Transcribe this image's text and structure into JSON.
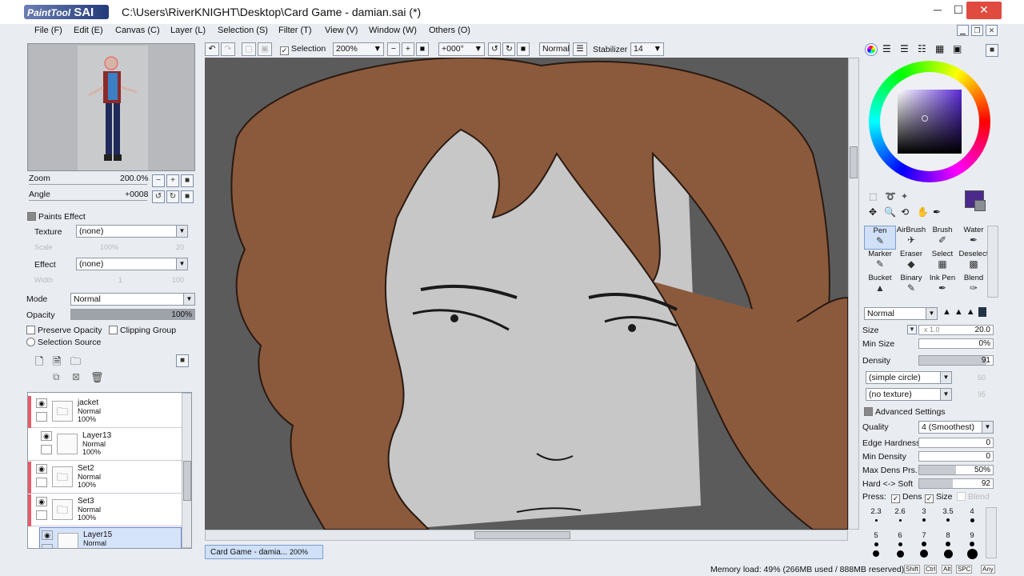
{
  "window": {
    "app_logo": "PaintTool",
    "app_logo_sai": "SAI",
    "title": "C:\\Users\\RiverKNIGHT\\Desktop\\Card Game - damian.sai (*)"
  },
  "menus": [
    "File (F)",
    "Edit (E)",
    "Canvas (C)",
    "Layer (L)",
    "Selection (S)",
    "Filter (T)",
    "View (V)",
    "Window (W)",
    "Others (O)"
  ],
  "navigator": {
    "zoom_label": "Zoom",
    "zoom_value": "200.0%",
    "angle_label": "Angle",
    "angle_value": "+0008"
  },
  "paint_effect": {
    "header": "Paints Effect",
    "texture_label": "Texture",
    "texture_value": "(none)",
    "scale_label": "Scale",
    "scale_value": "100%",
    "scale_num": "20",
    "effect_label": "Effect",
    "effect_value": "(none)",
    "width_label": "Width",
    "width_value": "1",
    "width_num": "100"
  },
  "layer_props": {
    "mode_label": "Mode",
    "mode_value": "Normal",
    "opacity_label": "Opacity",
    "opacity_value": "100%",
    "opacity_fraction": 1.0,
    "preserve_opacity": "Preserve Opacity",
    "clipping_group": "Clipping Group",
    "selection_source": "Selection Source"
  },
  "layers": [
    {
      "name": "jacket",
      "mode": "Normal",
      "opacity": "100%",
      "type": "folder",
      "marked": true
    },
    {
      "name": "Layer13",
      "mode": "Normal",
      "opacity": "100%",
      "type": "layer",
      "marked": false
    },
    {
      "name": "Set2",
      "mode": "Normal",
      "opacity": "100%",
      "type": "folder",
      "marked": true
    },
    {
      "name": "Set3",
      "mode": "Normal",
      "opacity": "100%",
      "type": "folder",
      "marked": true
    },
    {
      "name": "Layer15",
      "mode": "Normal",
      "opacity": "",
      "type": "layer",
      "marked": false
    }
  ],
  "toolbar": {
    "selection_label": "Selection",
    "zoom": "200%",
    "rotation": "+000°",
    "blend_mode": "Normal",
    "stabilizer_label": "Stabilizer",
    "stabilizer_value": "14"
  },
  "tools": [
    {
      "label": "Pen",
      "icon": "✎",
      "selected": true
    },
    {
      "label": "AirBrush",
      "icon": "✈",
      "selected": false
    },
    {
      "label": "Brush",
      "icon": "✐",
      "selected": false
    },
    {
      "label": "Water",
      "icon": "✒",
      "selected": false
    },
    {
      "label": "Marker",
      "icon": "✎",
      "selected": false
    },
    {
      "label": "Eraser",
      "icon": "◆",
      "selected": false
    },
    {
      "label": "Select",
      "icon": "▦",
      "selected": false
    },
    {
      "label": "Deselect",
      "icon": "▩",
      "selected": false
    },
    {
      "label": "Bucket",
      "icon": "▲",
      "selected": false
    },
    {
      "label": "Binary",
      "icon": "✎",
      "selected": false
    },
    {
      "label": "Ink Pen",
      "icon": "✒",
      "selected": false
    },
    {
      "label": "Blend",
      "icon": "✑",
      "selected": false
    }
  ],
  "brush": {
    "mode": "Normal",
    "size_label": "Size",
    "size_mult": "x 1.0",
    "size_value": "20.0",
    "min_size_label": "Min Size",
    "min_size_value": "0%",
    "density_label": "Density",
    "density_value": "91",
    "shape": "(simple circle)",
    "shape_num": "50",
    "texture": "(no texture)",
    "texture_num": "95",
    "advanced": "Advanced Settings",
    "quality_label": "Quality",
    "quality_value": "4 (Smoothest)",
    "edge_hardness_label": "Edge Hardness",
    "edge_hardness_value": "0",
    "min_density_label": "Min Density",
    "min_density_value": "0",
    "max_dens_label": "Max Dens Prs.",
    "max_dens_value": "50%",
    "hard_soft_label": "Hard <-> Soft",
    "hard_soft_value": "92",
    "press_label": "Press:",
    "press_dens": "Dens",
    "press_size": "Size",
    "press_blend": "Blend"
  },
  "brush_sizes": [
    "2.3",
    "2.6",
    "3",
    "3.5",
    "4",
    "5",
    "6",
    "7",
    "8",
    "9"
  ],
  "tabs": {
    "doc_name": "Card Game - damia...",
    "doc_zoom": "200%"
  },
  "status": {
    "memory": "Memory load: 49% (266MB used / 888MB reserved)",
    "keys": [
      "Shift",
      "Ctrl",
      "Alt",
      "SPC",
      "Any"
    ]
  },
  "colors": {
    "current": "#4b2a8c",
    "secondary": "#8a8f96",
    "hair": "#8b5a3c",
    "skin": "#c8c8c8"
  }
}
